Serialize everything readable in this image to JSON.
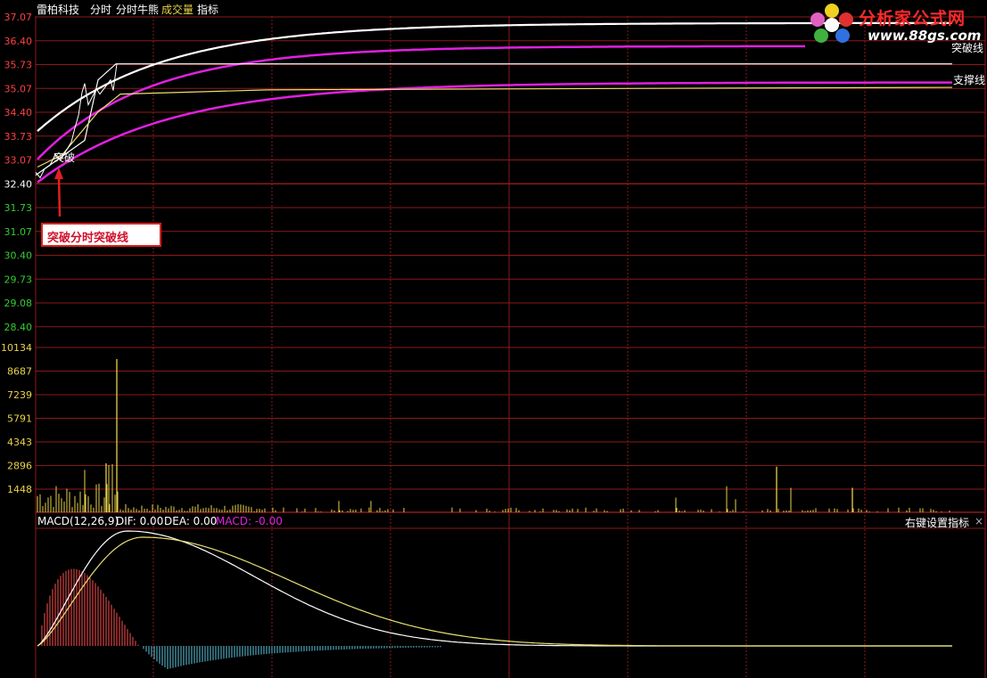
{
  "toolbar": {
    "stock_name": "雷柏科技",
    "tabs": [
      "分时",
      "分时牛熊",
      "成交量",
      "指标"
    ],
    "colors": [
      "#ffffff",
      "#ffffff",
      "#e8d24a",
      "#ffffff"
    ]
  },
  "price_axis": {
    "labels": [
      "37.07",
      "36.40",
      "35.73",
      "35.07",
      "34.40",
      "33.73",
      "33.07",
      "32.40",
      "31.73",
      "31.07",
      "30.40",
      "29.73",
      "29.08",
      "28.40"
    ],
    "colors": [
      "#ff4040",
      "#ff4040",
      "#ff4040",
      "#ff4040",
      "#ff4040",
      "#ff4040",
      "#ff4040",
      "#ffffff",
      "#33cc33",
      "#33cc33",
      "#33cc33",
      "#33cc33",
      "#33cc33",
      "#33cc33"
    ]
  },
  "volume_axis": {
    "labels": [
      "10134",
      "8687",
      "7239",
      "5791",
      "4343",
      "2896",
      "1448"
    ]
  },
  "chart_labels": {
    "breakout_marker": "突破",
    "breakout_line": "突破线",
    "support_line": "支撑线"
  },
  "annotation": {
    "text": "突破分时突破线"
  },
  "macd": {
    "title": "MACD(12,26,9)",
    "dif": "DIF: 0.00",
    "dea": "DEA: 0.00",
    "macd": "MACD: -0.00",
    "right_menu": "右键设置指标",
    "close": "×"
  },
  "logo": {
    "name": "分析家公式网",
    "url": "www.88gs.com"
  },
  "chart_data": {
    "type": "line",
    "price_levels": {
      "white_curve_final": 36.9,
      "upper_magenta_final": 36.25,
      "breakout_line": 35.75,
      "lower_magenta_final": 35.23,
      "support_line": 35.07
    },
    "volume_spikes": [
      {
        "x_frac": 0.085,
        "value": 9400
      },
      {
        "x_frac": 0.074,
        "value": 3000
      },
      {
        "x_frac": 0.78,
        "value": 2800
      },
      {
        "x_frac": 0.86,
        "value": 1500
      }
    ]
  },
  "colors": {
    "grid": "#8b1a1a",
    "price_up": "#ff4040",
    "price_down": "#33cc33",
    "white_line": "#ffffff",
    "magenta_line": "#e020e0",
    "yellow_line": "#e8e070",
    "volume": "#e8d24a",
    "macd_pos": "#ff5050",
    "macd_neg": "#5ec8e0"
  }
}
